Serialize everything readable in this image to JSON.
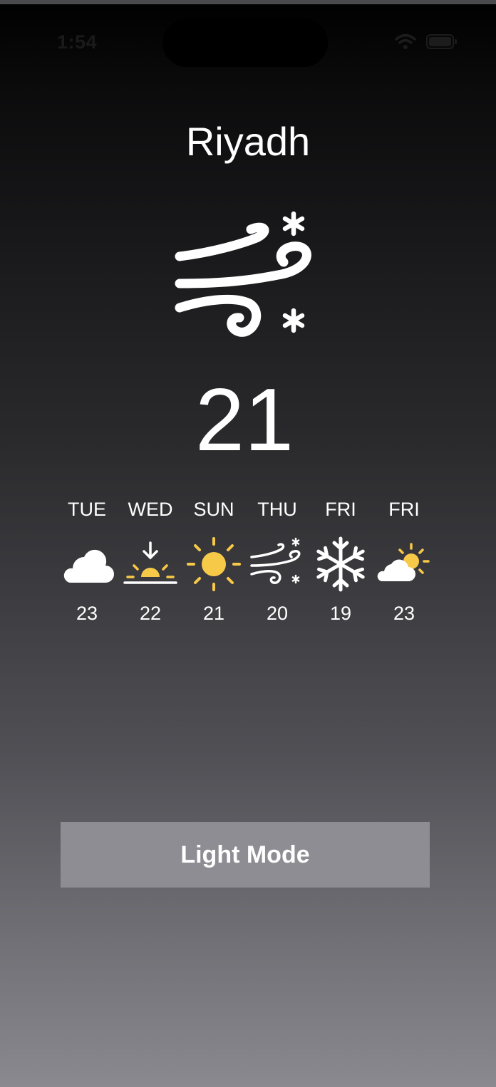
{
  "status_bar": {
    "time": "1:54",
    "icons": [
      "wifi-icon",
      "battery-icon"
    ]
  },
  "city": "Riyadh",
  "current": {
    "icon": "wind-snow-icon",
    "temperature": "21"
  },
  "forecast": [
    {
      "day": "TUE",
      "icon": "cloud-icon",
      "temp": "23"
    },
    {
      "day": "WED",
      "icon": "sunset-icon",
      "temp": "22"
    },
    {
      "day": "SUN",
      "icon": "sun-icon",
      "temp": "21"
    },
    {
      "day": "THU",
      "icon": "wind-snow-icon",
      "temp": "20"
    },
    {
      "day": "FRI",
      "icon": "snowflake-icon",
      "temp": "19"
    },
    {
      "day": "FRI",
      "icon": "partly-cloudy-icon",
      "temp": "23"
    }
  ],
  "button": {
    "label": "Light Mode"
  },
  "colors": {
    "accent_yellow": "#f7c948",
    "text": "#ffffff",
    "button_bg": "#8e8d93"
  }
}
